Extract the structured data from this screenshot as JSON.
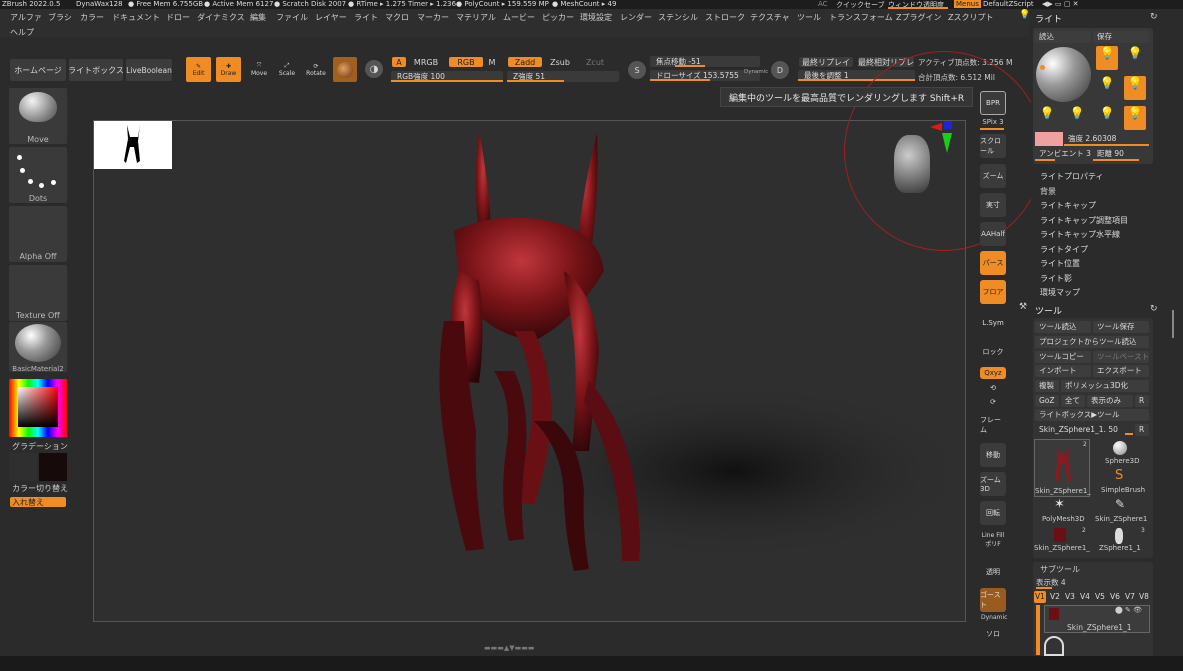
{
  "top": {
    "app": "ZBrush 2022.0.5",
    "doc": "DynaWax128",
    "freemem": "● Free Mem 6.755GB",
    "activemem": "● Active Mem 6127",
    "scratch": "● Scratch Disk 2007",
    "rtime": "● RTime ▸ 1.275 Timer ▸ 1.236",
    "polycount": "● PolyCount ▸ 159.559 MP",
    "meshcount": "● MeshCount ▸ 49",
    "ac": "AC",
    "quicksave": "クイックセーブ",
    "transparency": "ウィンドウ透明度",
    "menus": "Menus",
    "script": "DefaultZScript"
  },
  "menus": [
    "アルファ",
    "ブラシ",
    "カラー",
    "ドキュメント",
    "ドロー",
    "ダイナミクス",
    "編集",
    "ファイル",
    "レイヤー",
    "ライト",
    "マクロ",
    "マーカー",
    "マテリアル",
    "ムービー",
    "ピッカー",
    "環境設定",
    "レンダー",
    "ステンシル",
    "ストローク",
    "テクスチャ",
    "ツール",
    "トランスフォーム",
    "Zプラグイン",
    "Zスクリプト"
  ],
  "help": "ヘルプ",
  "nav": {
    "home": "ホームページ",
    "lightbox": "ライトボックス",
    "liveboolean": "LiveBoolean"
  },
  "toolbar": {
    "edit": "Edit",
    "draw": "Draw",
    "move": "Move",
    "scale": "Scale",
    "rotate": "Rotate",
    "a": "A",
    "mrgb": "MRGB",
    "rgb": "RGB",
    "m": "M",
    "zadd": "Zadd",
    "zsub": "Zsub",
    "zcut": "Zcut",
    "rgb_intensity": "RGB強度 100",
    "z_intensity": "Z強度 51",
    "focal": "焦点移動 -51",
    "drawsize": "ドローサイズ 153.5755",
    "dynamic": "Dynamic",
    "replay_last": "最終リプレイ",
    "replay_last_rel": "最終相対リプレ",
    "adjust_last": "最後を調整 1",
    "active_points": "アクティブ頂点数: 3.256 M",
    "total_points": "合計頂点数: 6.512 Mil"
  },
  "left": {
    "move": "Move",
    "dots": "Dots",
    "alpha": "Alpha Off",
    "texture": "Texture Off",
    "material": "BasicMaterial2",
    "gradient": "グラデーション",
    "switch": "カラー切り替え",
    "swap": "入れ替え"
  },
  "tooltip": "編集中のツールを最高品質でレンダリングします Shift+R",
  "vtools": [
    "BPR",
    "SPix 3",
    "スクロール",
    "ズーム",
    "実寸",
    "AAHalf",
    "パース",
    "フロア",
    "L.Sym",
    "ロック",
    "Qxyz",
    "",
    "",
    "フレーム",
    "移動",
    "ズーム3D",
    "回転",
    "Line Fill",
    "ポリF",
    "透明",
    "ゴースト",
    "Dynamic",
    "ソロ"
  ],
  "light": {
    "title": "ライト",
    "load": "読込",
    "save": "保存",
    "intensity": "強度 2.60308",
    "ambient": "アンビエント 3",
    "distance": "距離 90",
    "items": [
      "ライトプロパティ",
      "背景",
      "ライトキャップ",
      "ライトキャップ調整項目",
      "ライトキャップ水平線",
      "ライトタイプ",
      "ライト位置",
      "ライト影",
      "環境マップ"
    ]
  },
  "tool": {
    "title": "ツール",
    "load": "ツール読込",
    "save": "ツール保存",
    "loadproj": "プロジェクトからツール読込",
    "copy": "ツールコピー",
    "paste": "ツールペースト",
    "import": "インポート",
    "export": "エクスポート",
    "clone": "複製",
    "polymesh": "ポリメッシュ3D化",
    "goz": "GoZ",
    "all": "全て",
    "visible": "表示のみ",
    "r": "R",
    "lightbox": "ライトボックス▶ツール",
    "current": "Skin_ZSphere1_1. 50",
    "thumbs": [
      {
        "name": "Skin_ZSphere1_",
        "badge": "2"
      },
      {
        "name": "Sphere3D",
        "badge": ""
      },
      {
        "name": "SimpleBrush",
        "badge": ""
      },
      {
        "name": "PolyMesh3D",
        "badge": ""
      },
      {
        "name": "Skin_ZSphere1",
        "badge": ""
      },
      {
        "name": "Skin_ZSphere1_",
        "badge": "2"
      },
      {
        "name": "ZSphere1_1",
        "badge": "3"
      }
    ],
    "subtool": "サブツール",
    "visible_count": "表示数 4",
    "v": [
      "V1",
      "V2",
      "V3",
      "V4",
      "V5",
      "V6",
      "V7",
      "V8"
    ],
    "sub_item": "Skin_ZSphere1_1"
  },
  "colors": {
    "accent": "#f08c24",
    "model": "#8a1a1f"
  }
}
